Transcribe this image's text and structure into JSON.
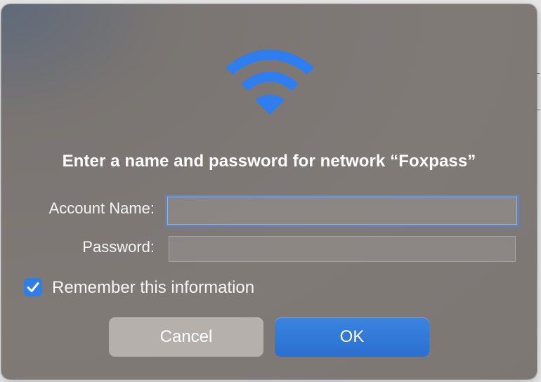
{
  "dialog": {
    "title": "Enter a name and password for network “Foxpass”",
    "account_label": "Account Name:",
    "account_value": "",
    "password_label": "Password:",
    "password_value": "",
    "remember_label": "Remember this information",
    "remember_checked": true,
    "cancel_label": "Cancel",
    "ok_label": "OK"
  },
  "colors": {
    "accent": "#2d7ee6",
    "wifi": "#2f7ef0"
  },
  "icons": {
    "wifi": "wifi-icon",
    "check": "checkmark-icon"
  }
}
